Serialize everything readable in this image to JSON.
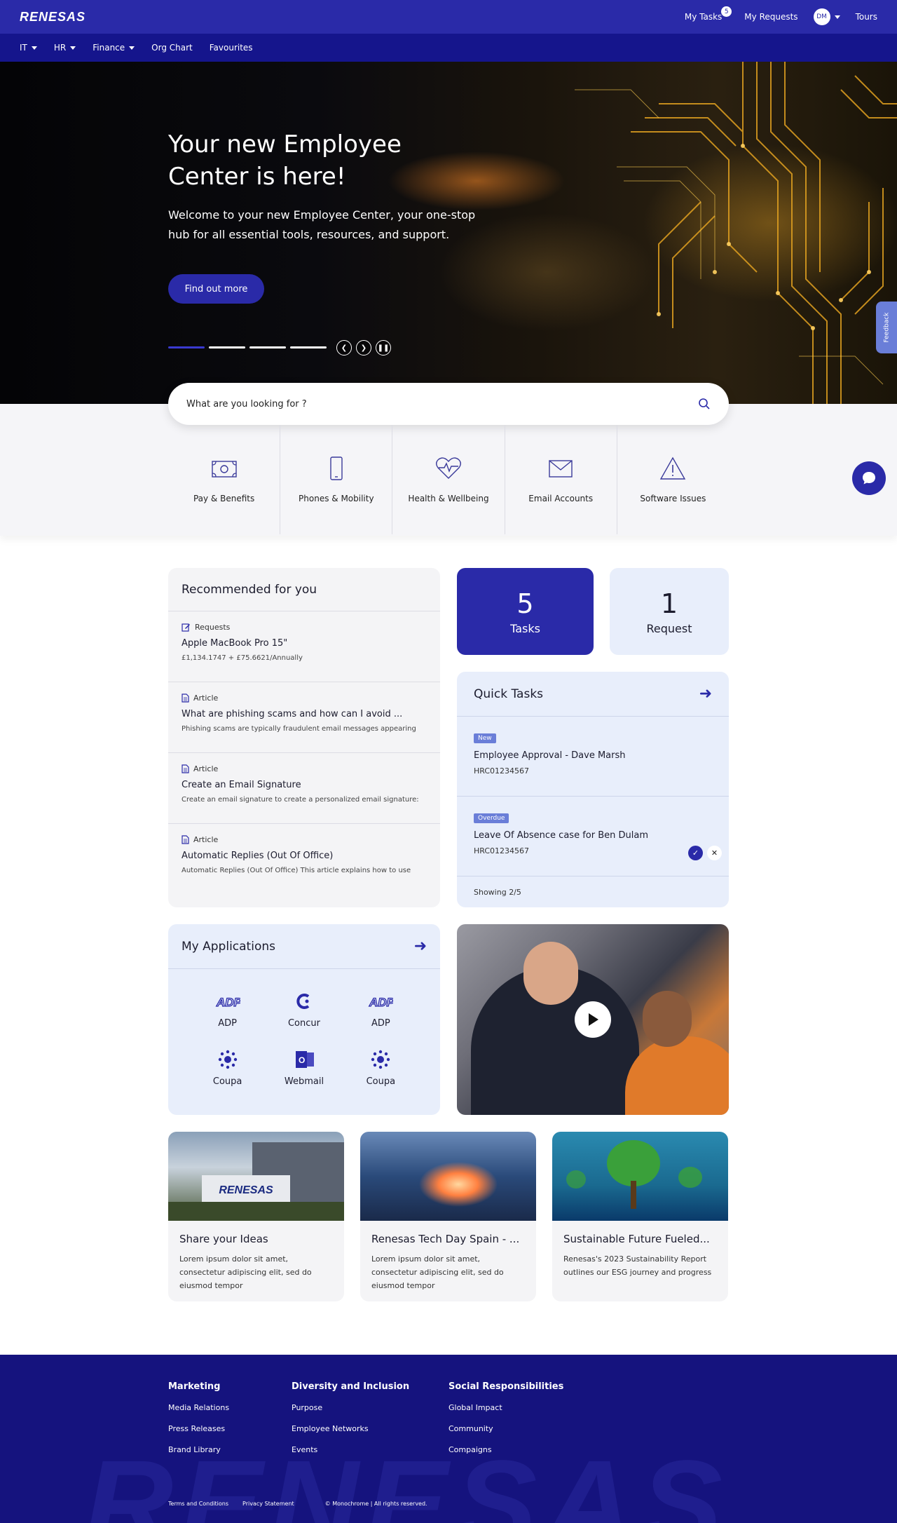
{
  "header": {
    "logo": "RENESAS",
    "my_tasks": "My Tasks",
    "tasks_badge": "5",
    "my_requests": "My Requests",
    "avatar_initials": "DM",
    "tours": "Tours"
  },
  "nav": {
    "items": [
      {
        "label": "IT",
        "dropdown": true
      },
      {
        "label": "HR",
        "dropdown": true
      },
      {
        "label": "Finance",
        "dropdown": true
      },
      {
        "label": "Org Chart",
        "dropdown": false
      },
      {
        "label": "Favourites",
        "dropdown": false
      }
    ]
  },
  "hero": {
    "title": "Your new Employee Center is here!",
    "subtitle": "Welcome to your new Employee Center, your one-stop hub for all essential tools, resources, and support.",
    "button": "Find out more",
    "slides": 4,
    "active_slide": 1,
    "feedback": "Feedback"
  },
  "search": {
    "placeholder": "What are you looking for ?"
  },
  "categories": [
    {
      "label": "Pay & Benefits",
      "icon": "money-icon"
    },
    {
      "label": "Phones & Mobility",
      "icon": "phone-icon"
    },
    {
      "label": "Health & Wellbeing",
      "icon": "heart-pulse-icon"
    },
    {
      "label": "Email Accounts",
      "icon": "envelope-icon"
    },
    {
      "label": "Software Issues",
      "icon": "warning-icon"
    }
  ],
  "recommended": {
    "title": "Recommended for you",
    "items": [
      {
        "type": "Requests",
        "title": "Apple MacBook Pro 15\"",
        "desc": "£1,134.1747 + £75.6621/Annually"
      },
      {
        "type": "Article",
        "title": "What are phishing scams and how can I avoid ...",
        "desc": "Phishing scams are typically fraudulent email messages appearing"
      },
      {
        "type": "Article",
        "title": "Create an Email Signature",
        "desc": "Create an email signature to create a personalized email signature:"
      },
      {
        "type": "Article",
        "title": "Automatic Replies (Out Of Office)",
        "desc": "Automatic Replies (Out Of Office) This article explains how to use"
      }
    ]
  },
  "counters": {
    "tasks_count": "5",
    "tasks_label": "Tasks",
    "requests_count": "1",
    "requests_label": "Request"
  },
  "quick_tasks": {
    "title": "Quick Tasks",
    "items": [
      {
        "tag": "New",
        "title": "Employee Approval - Dave Marsh",
        "id": "HRC01234567"
      },
      {
        "tag": "Overdue",
        "title": "Leave Of Absence case for Ben Dulam",
        "id": "HRC01234567"
      }
    ],
    "footer": "Showing 2/5"
  },
  "applications": {
    "title": "My Applications",
    "items": [
      {
        "label": "ADP",
        "icon": "adp-icon"
      },
      {
        "label": "Concur",
        "icon": "concur-icon"
      },
      {
        "label": "ADP",
        "icon": "adp-icon"
      },
      {
        "label": "Coupa",
        "icon": "coupa-icon"
      },
      {
        "label": "Webmail",
        "icon": "outlook-icon"
      },
      {
        "label": "Coupa",
        "icon": "coupa-icon"
      }
    ]
  },
  "news": [
    {
      "title": "Share your Ideas",
      "desc": "Lorem ipsum dolor sit amet, consectetur adipiscing elit, sed do eiusmod tempor"
    },
    {
      "title": "Renesas Tech Day Spain - ...",
      "desc": "Lorem ipsum dolor sit amet, consectetur adipiscing elit, sed do eiusmod tempor"
    },
    {
      "title": "Sustainable Future Fueled...",
      "desc": "Renesas's 2023 Sustainability Report outlines our ESG journey and progress"
    }
  ],
  "footer": {
    "columns": [
      {
        "heading": "Marketing",
        "links": [
          "Media Relations",
          "Press Releases",
          "Brand Library"
        ]
      },
      {
        "heading": "Diversity and Inclusion",
        "links": [
          "Purpose",
          "Employee Networks",
          "Events"
        ]
      },
      {
        "heading": "Social Responsibilities",
        "links": [
          "Global Impact",
          "Community",
          "Compaigns"
        ]
      }
    ],
    "legal": [
      "Terms and Conditions",
      "Privacy Statement",
      "© Monochrome | All rights reserved."
    ],
    "watermark": "RENESAS"
  },
  "colors": {
    "brand": "#2a2aa8",
    "nav": "#15158c",
    "footer": "#15137e",
    "tag": "#6a7ed8"
  }
}
